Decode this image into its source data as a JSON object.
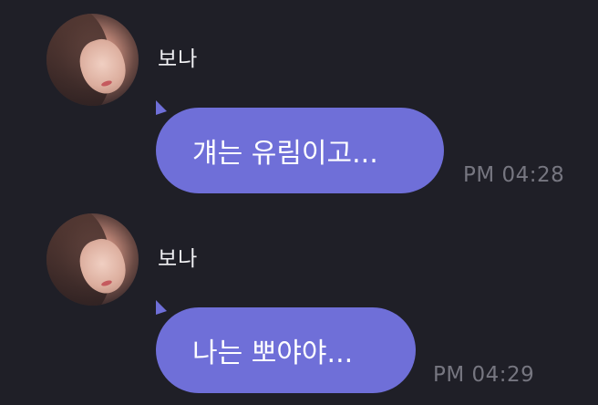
{
  "messages": [
    {
      "sender": "보나",
      "text": "걔는 유림이고...",
      "time": "PM 04:28",
      "avatar_icon": "profile-photo"
    },
    {
      "sender": "보나",
      "text": "나는 뽀야야...",
      "time": "PM 04:29",
      "avatar_icon": "profile-photo"
    }
  ],
  "colors": {
    "background": "#1f1f27",
    "bubble": "#6f6fd8",
    "timestamp": "#767680",
    "name": "#f2f2f5"
  }
}
